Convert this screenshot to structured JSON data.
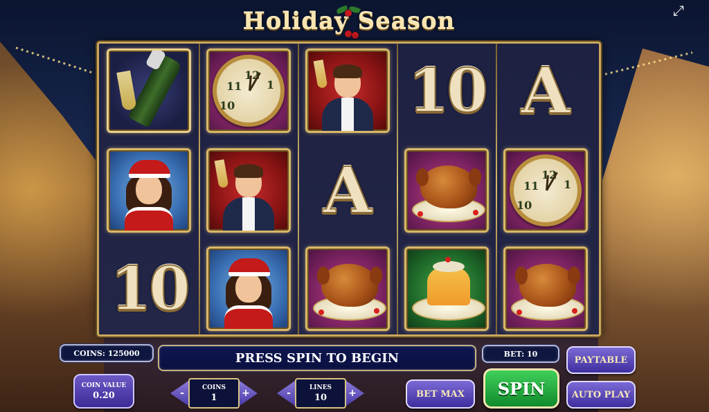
{
  "game": {
    "title": "Holiday Season"
  },
  "header": {
    "fullscreen_icon": "expand-arrows-icon"
  },
  "reels": {
    "columns": [
      [
        "champagne-wild",
        "santa-girl",
        "ten"
      ],
      [
        "clock",
        "man-toast",
        "santa-girl"
      ],
      [
        "man-toast",
        "ace",
        "turkey"
      ],
      [
        "ten",
        "turkey",
        "pudding"
      ],
      [
        "ace",
        "clock",
        "turkey"
      ]
    ],
    "ten_text": "10",
    "ace_text": "A",
    "clock_numbers": [
      "12",
      "11",
      "1",
      "10"
    ]
  },
  "controls": {
    "coins_display": "COINS: 125000",
    "message": "PRESS SPIN TO BEGIN",
    "bet_display": "BET: 10",
    "coin_value": {
      "label": "COIN VALUE",
      "value": "0.20"
    },
    "coins_stepper": {
      "label": "COINS",
      "value": "1",
      "minus": "-",
      "plus": "+"
    },
    "lines_stepper": {
      "label": "LINES",
      "value": "10",
      "minus": "-",
      "plus": "+"
    },
    "bet_max_label": "BET MAX",
    "spin_label": "SPIN",
    "paytable_label": "PAYTABLE",
    "autoplay_label": "AUTO PLAY"
  },
  "colors": {
    "spin_green": "#1fae3c",
    "button_purple": "#5a48bc",
    "frame_gold": "#c9a85b"
  }
}
